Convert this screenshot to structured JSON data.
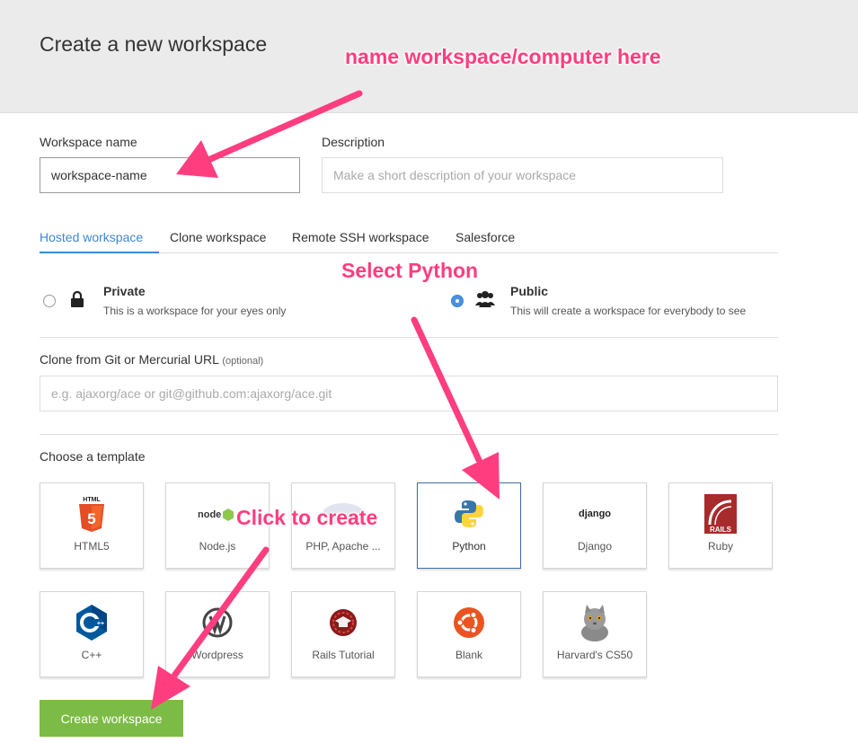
{
  "header": {
    "title": "Create a new workspace"
  },
  "form": {
    "name_label": "Workspace name",
    "name_value": "workspace-name",
    "desc_label": "Description",
    "desc_placeholder": "Make a short description of your workspace"
  },
  "tabs": [
    {
      "label": "Hosted workspace",
      "active": true
    },
    {
      "label": "Clone workspace"
    },
    {
      "label": "Remote SSH workspace"
    },
    {
      "label": "Salesforce"
    }
  ],
  "visibility": {
    "private": {
      "title": "Private",
      "desc": "This is a workspace for your eyes only",
      "selected": false
    },
    "public": {
      "title": "Public",
      "desc": "This will create a workspace for everybody to see",
      "selected": true
    }
  },
  "clone": {
    "label": "Clone from Git or Mercurial URL",
    "optional": "(optional)",
    "placeholder": "e.g. ajaxorg/ace or git@github.com:ajaxorg/ace.git"
  },
  "templates": {
    "label": "Choose a template",
    "items": [
      {
        "name": "HTML5",
        "icon": "html5-icon"
      },
      {
        "name": "Node.js",
        "icon": "nodejs-icon",
        "logo_text": "node"
      },
      {
        "name": "PHP, Apache ...",
        "icon": "php-icon"
      },
      {
        "name": "Python",
        "icon": "python-icon",
        "selected": true
      },
      {
        "name": "Django",
        "icon": "django-icon",
        "logo_text": "django"
      },
      {
        "name": "Ruby",
        "icon": "rails-icon",
        "logo_text": "RAILS"
      },
      {
        "name": "C++",
        "icon": "cpp-icon"
      },
      {
        "name": "Wordpress",
        "icon": "wordpress-icon"
      },
      {
        "name": "Rails Tutorial",
        "icon": "rails-tutorial-icon"
      },
      {
        "name": "Blank",
        "icon": "ubuntu-icon"
      },
      {
        "name": "Harvard's CS50",
        "icon": "cs50-cat-icon"
      }
    ]
  },
  "create_button": "Create workspace",
  "annotations": {
    "name_hint": "name workspace/computer here",
    "python_hint": "Select Python",
    "create_hint": "Click to create",
    "color": "#ff3d7f"
  },
  "colors": {
    "accent": "#3f87d5",
    "create": "#7dbb47"
  }
}
